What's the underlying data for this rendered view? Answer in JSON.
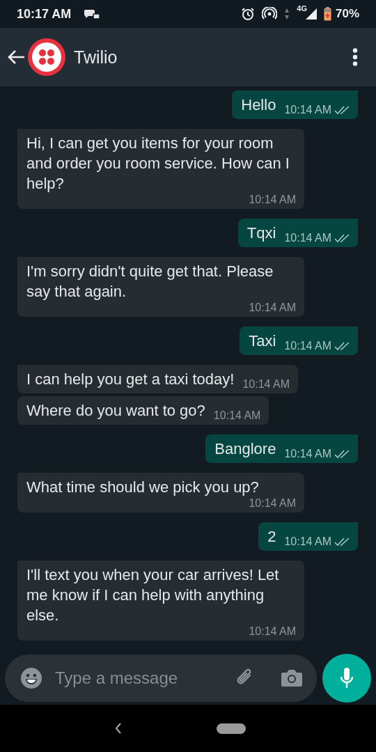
{
  "status_bar": {
    "time": "10:17 AM",
    "network": "4G",
    "battery": "70%"
  },
  "header": {
    "title": "Twilio"
  },
  "messages": [
    {
      "kind": "sent",
      "text": "Hello",
      "time": "10:14 AM",
      "read": false
    },
    {
      "kind": "received",
      "text": "Hi, I can get you items for your room and order you room service. How can I help?",
      "time": "10:14 AM"
    },
    {
      "kind": "sent",
      "text": "Tqxi",
      "time": "10:14 AM",
      "read": false
    },
    {
      "kind": "received",
      "text": "I'm sorry didn't quite get that. Please say that again.",
      "time": "10:14 AM"
    },
    {
      "kind": "sent",
      "text": "Taxi",
      "time": "10:14 AM",
      "read": false
    },
    {
      "kind": "received",
      "text": "I can help you get a taxi today!",
      "time": "10:14 AM"
    },
    {
      "kind": "received",
      "text": "Where do you want to go?",
      "time": "10:14 AM"
    },
    {
      "kind": "sent",
      "text": "Banglore",
      "time": "10:14 AM",
      "read": false
    },
    {
      "kind": "received",
      "text": "What time should we pick you up?",
      "time": "10:14 AM"
    },
    {
      "kind": "sent",
      "text": "2",
      "time": "10:14 AM",
      "read": false
    },
    {
      "kind": "received",
      "text": "I'll text you when your car arrives! Let me know if I can help with anything else.",
      "time": "10:14 AM"
    }
  ],
  "composer": {
    "placeholder": "Type a message"
  }
}
